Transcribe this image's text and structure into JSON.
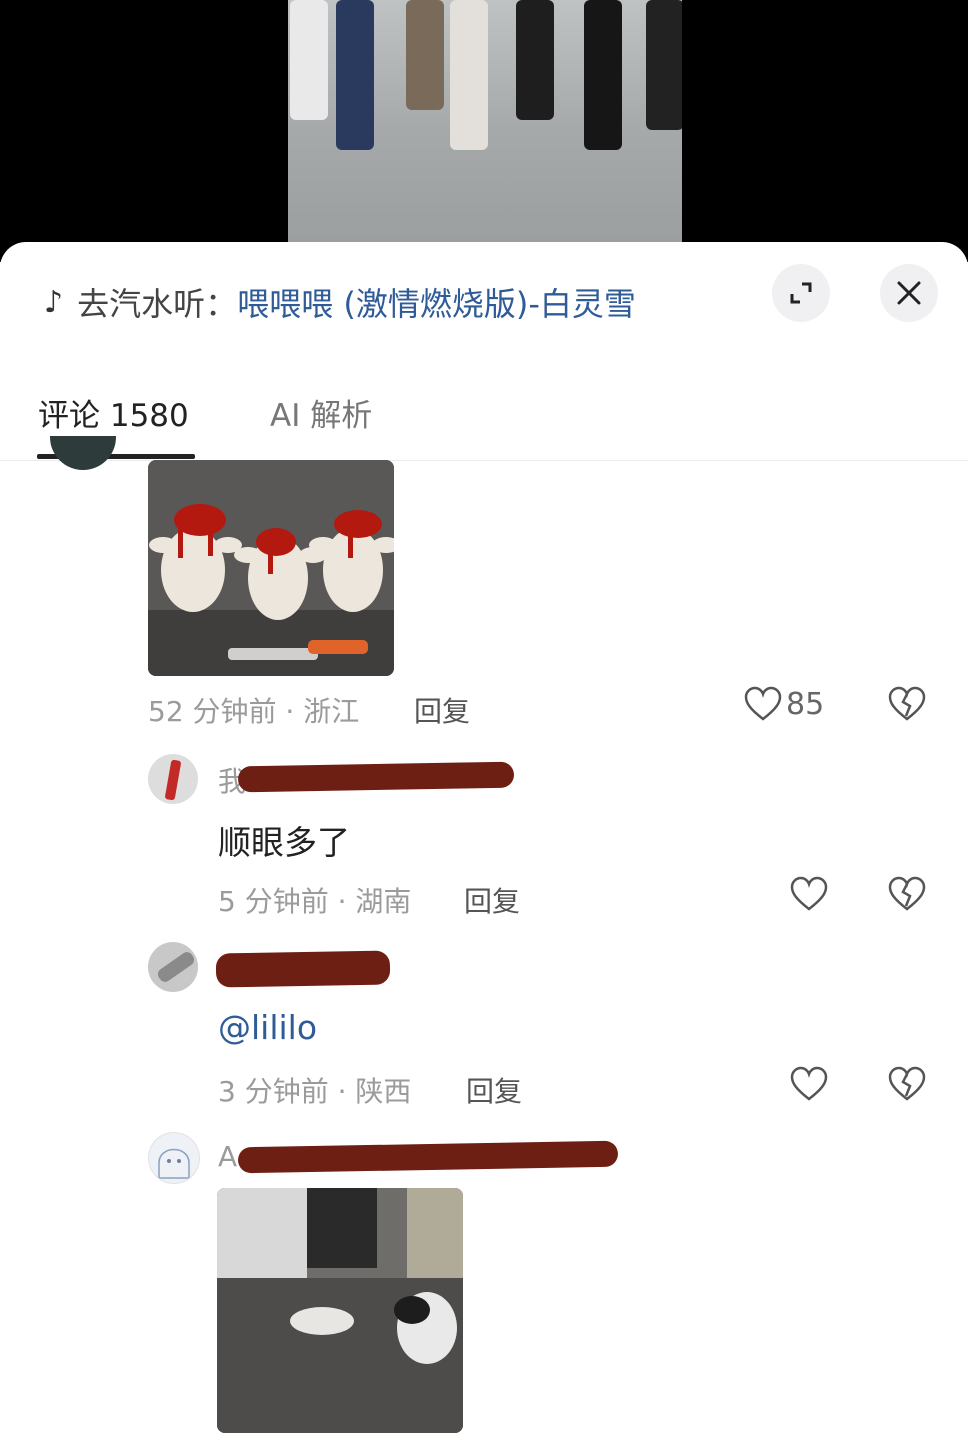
{
  "music": {
    "icon": "music-note-icon",
    "prefix": "去汽水听：",
    "song": "喂喂喂 (激情燃烧版)-白灵雪"
  },
  "tabs": [
    {
      "label": "评论 1580",
      "active": true
    },
    {
      "label": "AI 解析",
      "active": false
    }
  ],
  "comments": [
    {
      "time": "52 分钟前 · 浙江",
      "reply": "回复",
      "likes": "85"
    },
    {
      "name_stub": "我",
      "text": "顺眼多了",
      "time": "5 分钟前 · 湖南",
      "reply": "回复"
    },
    {
      "mention": "@lililo",
      "time": "3 分钟前 · 陕西",
      "reply": "回复"
    },
    {
      "name_stub": "A"
    }
  ],
  "colors": {
    "accent_link": "#2f5b98",
    "redaction": "#6e1f14"
  }
}
